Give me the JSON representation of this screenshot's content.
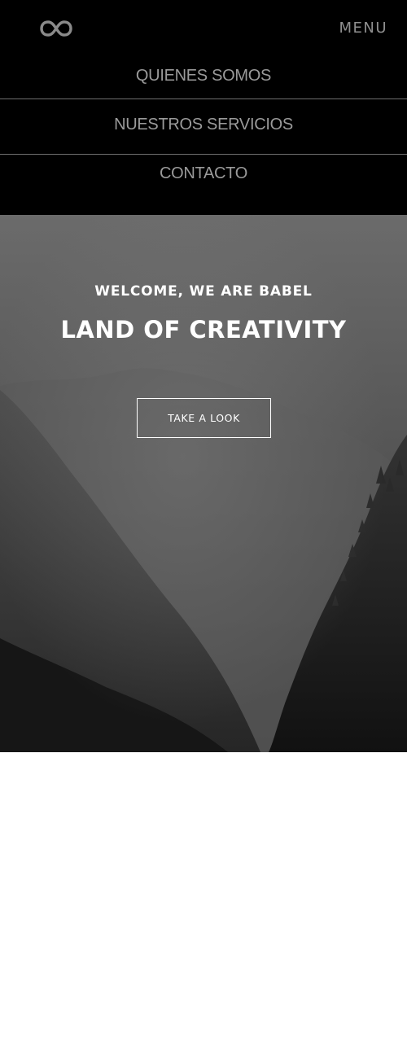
{
  "header": {
    "logo_icon": "infinity-icon",
    "menu_label": "MENU"
  },
  "nav": {
    "items": [
      {
        "label": "QUIENES SOMOS"
      },
      {
        "label": "NUESTROS SERVICIOS"
      },
      {
        "label": "CONTACTO"
      }
    ]
  },
  "hero": {
    "subtitle": "WELCOME, WE ARE BABEL",
    "title": "LAND OF CREATIVITY",
    "cta_label": "TAKE A LOOK",
    "background": "misty-mountain-forest-image"
  },
  "colors": {
    "header_bg": "#000000",
    "nav_text": "#9a9a9a",
    "hero_text": "#ffffff",
    "page_bg": "#ffffff"
  }
}
